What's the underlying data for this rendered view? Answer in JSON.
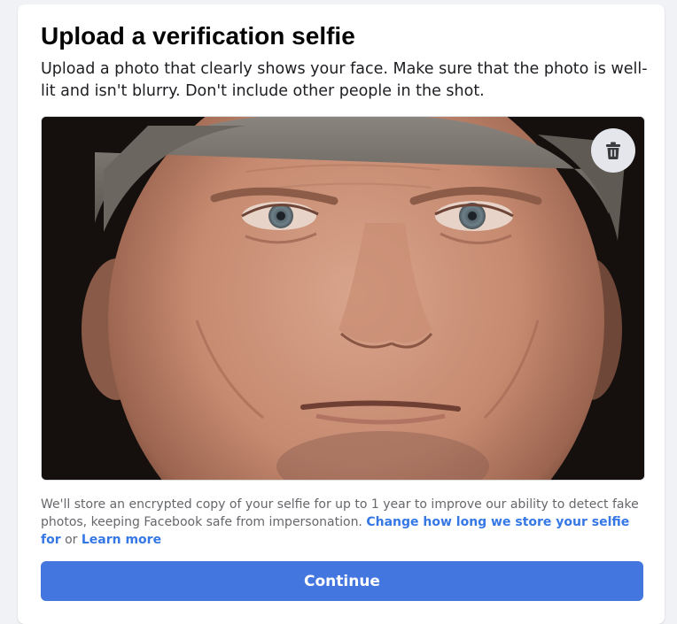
{
  "dialog": {
    "title": "Upload a verification selfie",
    "subtitle": "Upload a photo that clearly shows your face. Make sure that the photo is well-lit and isn't blurry. Don't include other people in the shot."
  },
  "photo": {
    "subject": "close-up portrait of a man's face",
    "delete_icon": "trash-icon"
  },
  "disclaimer": {
    "text": "We'll store an encrypted copy of your selfie for up to 1 year to improve our ability to detect fake photos, keeping Facebook safe from impersonation. ",
    "link_storage": "Change how long we store your selfie for",
    "connector": " or ",
    "link_learn": "Learn more"
  },
  "actions": {
    "continue_label": "Continue"
  },
  "colors": {
    "primary": "#4476e0",
    "link": "#3578e5",
    "page_bg": "#f0f2f5"
  }
}
